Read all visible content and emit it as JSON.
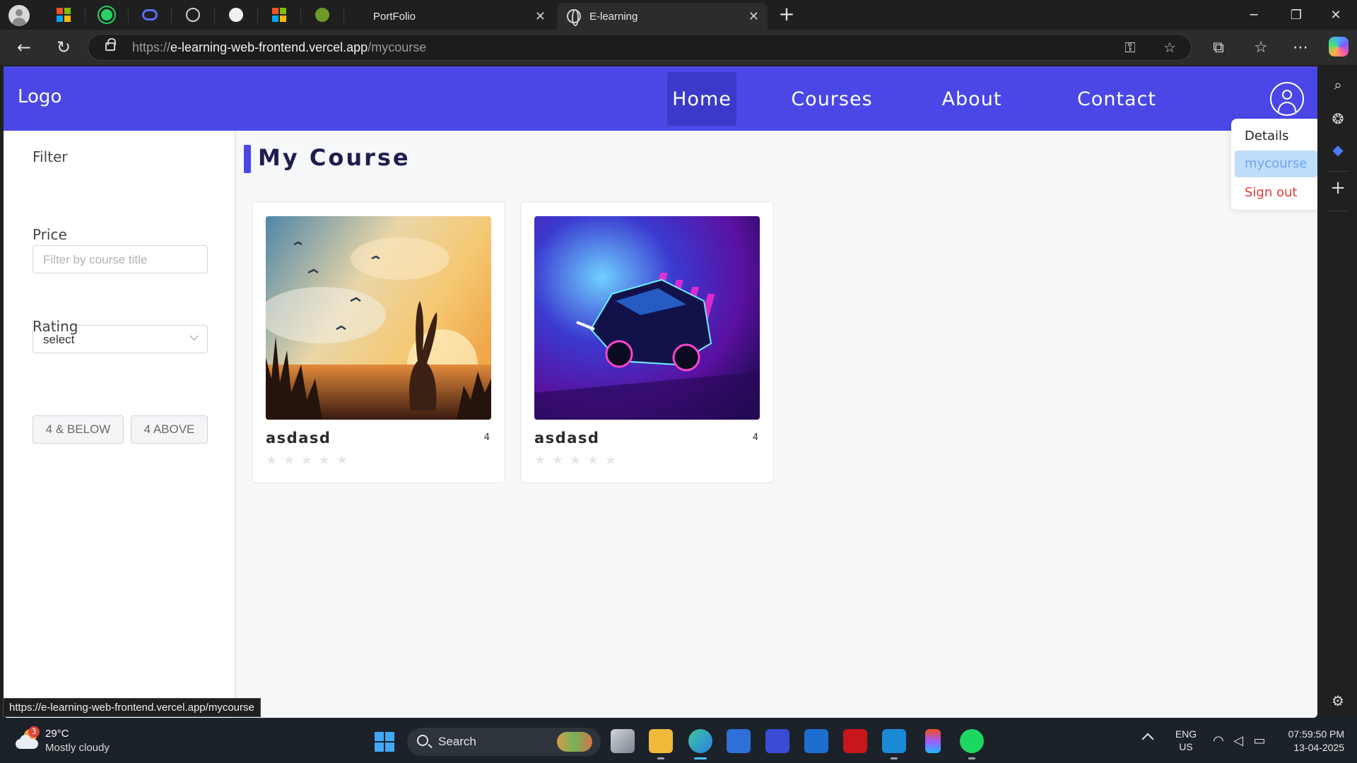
{
  "browser": {
    "tabs": [
      {
        "title": "PortFolio",
        "active": false
      },
      {
        "title": "E-learning",
        "active": true
      }
    ],
    "address": {
      "scheme": "https://",
      "host": "e-learning-web-frontend.vercel.app",
      "path": "/mycourse"
    },
    "status_url": "https://e-learning-web-frontend.vercel.app/mycourse"
  },
  "site": {
    "logo": "Logo",
    "nav": [
      "Home",
      "Courses",
      "About",
      "Contact"
    ],
    "active_nav": "Home",
    "accent_color": "#4a47e6",
    "user_menu": {
      "items": [
        "Details",
        "mycourse",
        "Sign out"
      ],
      "selected": "mycourse"
    }
  },
  "filters": {
    "filter_label": "Filter",
    "filter_placeholder": "Filter by course title",
    "price_label": "Price",
    "price_value": "select",
    "rating_label": "Rating",
    "rating_options": [
      "4 & BELOW",
      "4 ABOVE"
    ]
  },
  "main": {
    "title": "My Course",
    "courses": [
      {
        "title": "asdasd",
        "rating": "4",
        "stars_filled": 0,
        "stars_total": 5,
        "image": "rabbit silhouette at sunset"
      },
      {
        "title": "asdasd",
        "rating": "4",
        "stars_filled": 0,
        "stars_total": 5,
        "image": "neon sports car"
      }
    ]
  },
  "taskbar": {
    "weather_badge": "3",
    "temperature": "29°C",
    "weather": "Mostly cloudy",
    "search_label": "Search",
    "lang_1": "ENG",
    "lang_2": "US",
    "time": "07:59:50 PM",
    "date": "13-04-2025"
  }
}
